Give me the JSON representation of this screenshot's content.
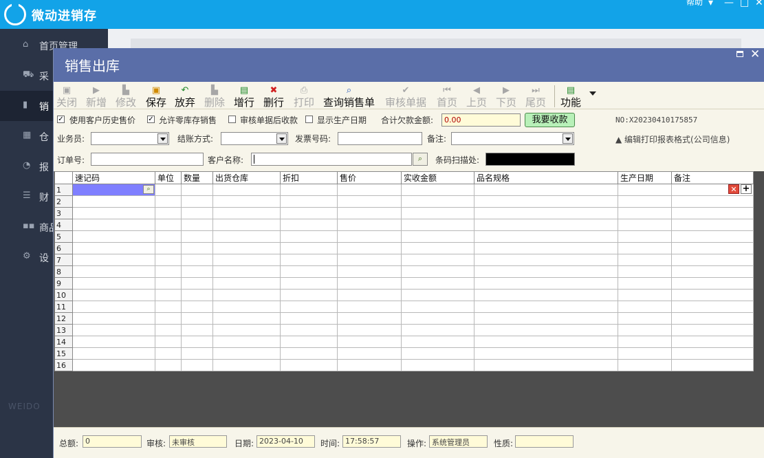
{
  "app": {
    "title": "微动进销存",
    "help": "帮助"
  },
  "sidebar": {
    "items": [
      {
        "icon": "home-icon",
        "label": "首页管理"
      },
      {
        "icon": "cart-icon",
        "label": "采"
      },
      {
        "icon": "sales-icon",
        "label": "销"
      },
      {
        "icon": "warehouse-icon",
        "label": "仓"
      },
      {
        "icon": "chart-icon",
        "label": "报"
      },
      {
        "icon": "finance-icon",
        "label": "财"
      },
      {
        "icon": "grid-icon",
        "label": "商品"
      },
      {
        "icon": "gear-icon",
        "label": "设"
      }
    ],
    "watermark": "WEIDO"
  },
  "dialog": {
    "title": "销售出库",
    "toolbar": [
      {
        "icon": "close-doc-icon",
        "label": "关闭",
        "enabled": false
      },
      {
        "icon": "new-icon",
        "label": "新增",
        "enabled": false
      },
      {
        "icon": "edit-icon",
        "label": "修改",
        "enabled": false
      },
      {
        "icon": "save-icon",
        "label": "保存",
        "enabled": true
      },
      {
        "icon": "undo-icon",
        "label": "放弃",
        "enabled": true
      },
      {
        "icon": "delete-icon",
        "label": "删除",
        "enabled": false
      },
      {
        "icon": "add-row-icon",
        "label": "增行",
        "enabled": true
      },
      {
        "icon": "delete-row-icon",
        "label": "删行",
        "enabled": true
      },
      {
        "icon": "print-icon",
        "label": "打印",
        "enabled": false
      },
      {
        "icon": "search-icon",
        "label": "查询销售单",
        "enabled": true
      },
      {
        "icon": "check-icon",
        "label": "审核单据",
        "enabled": false
      },
      {
        "icon": "first-page-icon",
        "label": "首页",
        "enabled": false
      },
      {
        "icon": "prev-page-icon",
        "label": "上页",
        "enabled": false
      },
      {
        "icon": "next-page-icon",
        "label": "下页",
        "enabled": false
      },
      {
        "icon": "last-page-icon",
        "label": "尾页",
        "enabled": false
      },
      {
        "icon": "function-icon",
        "label": "功能",
        "enabled": true
      }
    ],
    "options": {
      "use_history_price": "使用客户历史售价",
      "allow_zero_stock": "允许零库存销售",
      "audit_then_receive": "审核单据后收款",
      "show_production_date": "显示生产日期",
      "total_debt_label": "合计欠款金额:",
      "total_debt_value": "0.00",
      "pay_button": "我要收款",
      "order_no": "NO:X20230410175857"
    },
    "form": {
      "salesman_label": "业务员:",
      "settle_label": "结账方式:",
      "invoice_label": "发票号码:",
      "remark_label": "备注:",
      "edit_print_format": "编辑打印报表格式(公司信息)",
      "order_label": "订单号:",
      "customer_label": "客户名称:",
      "barcode_label": "条码扫描处:"
    },
    "grid": {
      "columns": [
        "速记码",
        "单位",
        "数量",
        "出货仓库",
        "折扣",
        "售价",
        "实收金额",
        "品名规格",
        "生产日期",
        "备注"
      ],
      "rows": [
        "1",
        "2",
        "3",
        "4",
        "5",
        "6",
        "7",
        "8",
        "9",
        "10",
        "11",
        "12",
        "13",
        "14",
        "15",
        "16"
      ]
    },
    "status": {
      "total_label": "总额:",
      "total_value": "0",
      "audit_label": "审核:",
      "audit_value": "未审核",
      "date_label": "日期:",
      "date_value": "2023-04-10",
      "time_label": "时间:",
      "time_value": "17:58:57",
      "operator_label": "操作:",
      "operator_value": "系统管理员",
      "nature_label": "性质:",
      "nature_value": ""
    }
  }
}
